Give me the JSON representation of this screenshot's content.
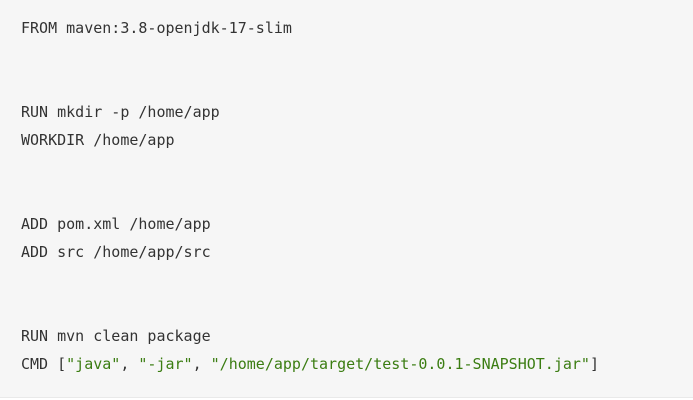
{
  "code": {
    "line1": "FROM maven:3.8-openjdk-17-slim",
    "line2": "RUN mkdir -p /home/app",
    "line3": "WORKDIR /home/app",
    "line4": "ADD pom.xml /home/app",
    "line5": "ADD src /home/app/src",
    "line6": "RUN mvn clean package",
    "line7": {
      "keyword": "CMD ",
      "open_bracket": "[",
      "str1": "\"java\"",
      "sep1": ", ",
      "str2": "\"-jar\"",
      "sep2": ", ",
      "str3": "\"/home/app/target/test-0.0.1-SNAPSHOT.jar\"",
      "close_bracket": "]"
    }
  },
  "colors": {
    "background": "#f6f6f6",
    "text": "#333333",
    "string": "#3b7d12"
  }
}
